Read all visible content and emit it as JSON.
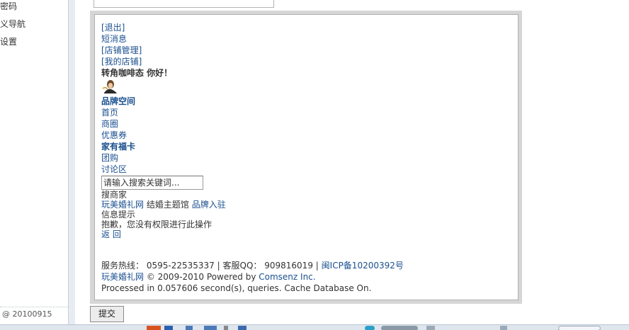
{
  "sidebar": {
    "items": [
      {
        "label": "密码"
      },
      {
        "label": "义导航"
      },
      {
        "label": "设置"
      }
    ],
    "version": "@ 20100915"
  },
  "preview": {
    "user_links": {
      "logout": "[退出]",
      "messages": "短消息",
      "shop_manage": "[店铺管理]",
      "my_shop": "[我的店铺]"
    },
    "greeting": "转角咖啡态  你好！",
    "nav": {
      "brand_space": "品牌空间",
      "home": "首页",
      "business_circle": "商圈",
      "coupons": "优惠券",
      "family_card": "家有福卡",
      "group_buy": "团购",
      "forum": "讨论区"
    },
    "search": {
      "placeholder": "请输入搜索关键词...",
      "button_label": "搜商家"
    },
    "site_links": {
      "site": "玩美婚礼网",
      "theme_hall": "结婚主题馆",
      "brand_join": "品牌入驻"
    },
    "message": {
      "title": "信息提示",
      "text": "抱歉，您没有权限进行此操作",
      "back": "返 回"
    },
    "footer": {
      "hotline_label": "服务热线：",
      "hotline": "0595-22535337",
      "sep1": "|",
      "qq_label": "客服QQ：",
      "qq": "909816019",
      "sep2": "|",
      "icp": "闽ICP备10200392号",
      "site": "玩美婚礼网",
      "copyright": "© 2009-2010 Powered by",
      "powered_by": "Comsenz Inc.",
      "processed": "Processed in 0.057606 second(s), queries. Cache Database On."
    }
  },
  "form": {
    "submit_label": "提交"
  },
  "colors": {
    "link": "#1a4f8f",
    "frame": "#d6d6d6",
    "sidebar_border": "#e6ecf1"
  }
}
